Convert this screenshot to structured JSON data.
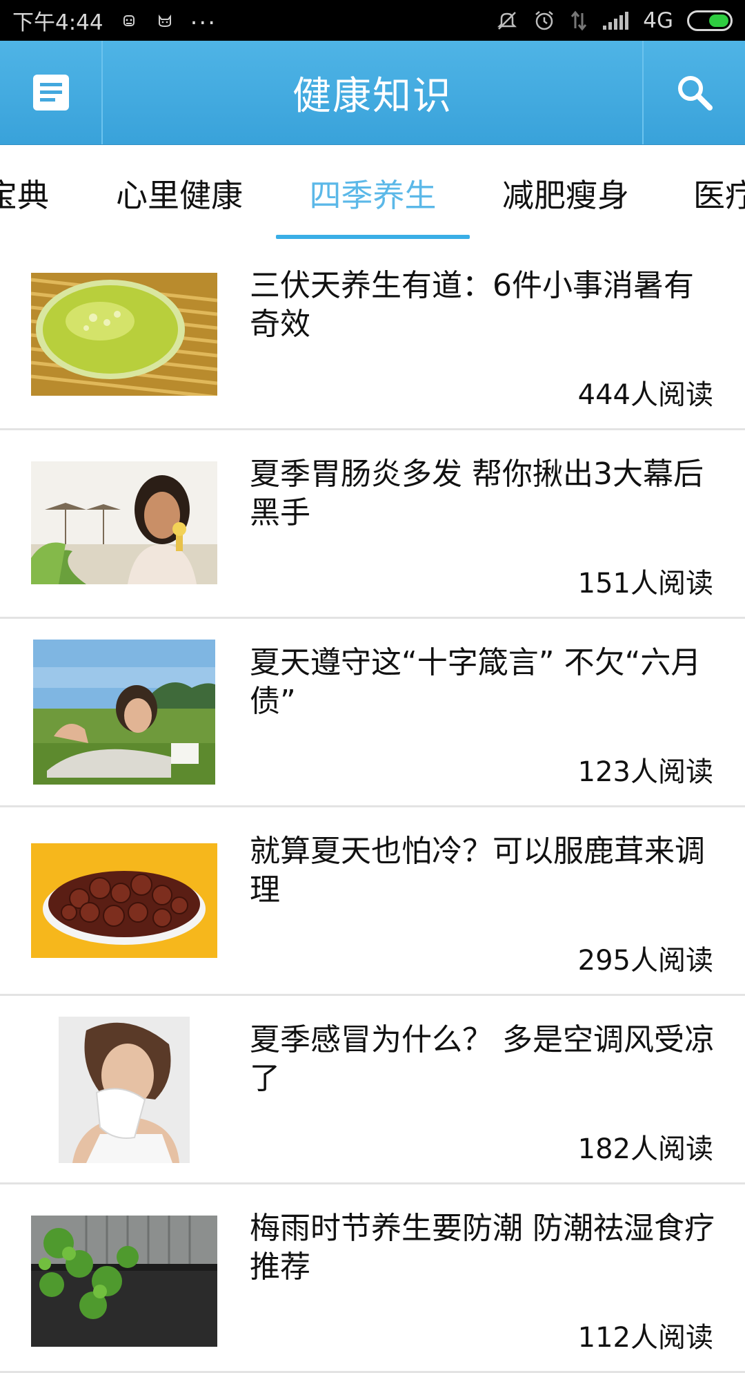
{
  "status_bar": {
    "time": "下午4:44",
    "network": "4G",
    "icons": [
      "bug-icon",
      "cat-icon",
      "more-dots-icon",
      "mute-icon",
      "alarm-icon",
      "data-arrows-icon",
      "signal-icon",
      "battery-icon"
    ],
    "dots": "..."
  },
  "appbar": {
    "title": "健康知识",
    "left_icon": "document-icon",
    "right_icon": "search-icon",
    "accent": "#3aaee6"
  },
  "tabs": [
    {
      "label": "宝典",
      "active": false
    },
    {
      "label": "心里健康",
      "active": false
    },
    {
      "label": "四季养生",
      "active": true
    },
    {
      "label": "减肥瘦身",
      "active": false
    },
    {
      "label": "医疗",
      "active": false
    }
  ],
  "articles": [
    {
      "title": "三伏天养生有道：6件小事消暑有奇效",
      "reads": "444人阅读",
      "thumb": "green-soup"
    },
    {
      "title": "夏季胃肠炎多发 帮你揪出3大幕后黑手",
      "reads": "151人阅读",
      "thumb": "woman-beach-icecream"
    },
    {
      "title": "夏天遵守这“十字箴言” 不欠“六月债”",
      "reads": "123人阅读",
      "thumb": "woman-lying-grass"
    },
    {
      "title": "就算夏天也怕冷？可以服鹿茸来调理",
      "reads": "295人阅读",
      "thumb": "dried-slices-plate"
    },
    {
      "title": "夏季感冒为什么？ 多是空调风受凉了",
      "reads": "182人阅读",
      "thumb": "woman-sneezing"
    },
    {
      "title": "梅雨时节养生要防潮 防潮祛湿食疗推荐",
      "reads": "112人阅读",
      "thumb": "rainy-roof-tree"
    }
  ]
}
